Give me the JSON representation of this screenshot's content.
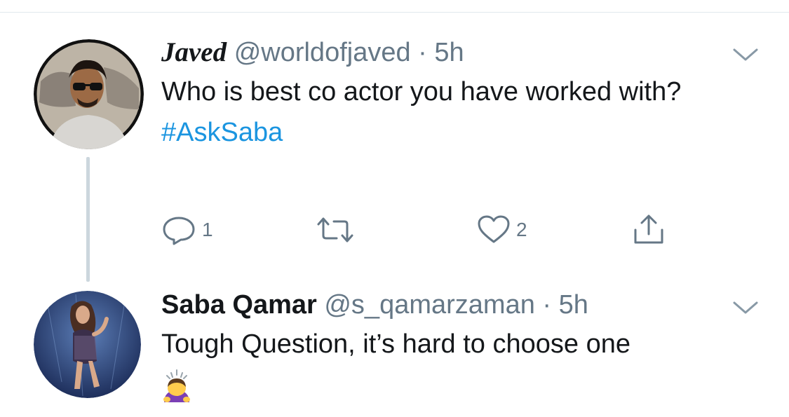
{
  "tweets": [
    {
      "display_name": "Javed",
      "handle": "@worldofjaved",
      "separator": "·",
      "time": "5h",
      "text": "Who is best co actor you have worked with?",
      "hashtag": "#AskSaba",
      "actions": {
        "reply_count": "1",
        "retweet_count": "",
        "like_count": "2"
      }
    },
    {
      "display_name": "Saba Qamar",
      "handle": "@s_qamarzaman",
      "separator": "·",
      "time": "5h",
      "text": "Tough Question, it’s hard to choose one",
      "emoji_icon": "person-bowing-icon"
    }
  ],
  "colors": {
    "link": "#1b95e0",
    "secondary_text": "#657786",
    "icon_gray": "#657786",
    "divider": "#e1e8ed",
    "thread_line": "#ccd6dd"
  },
  "icons": [
    "chevron-down-icon",
    "reply-icon",
    "retweet-icon",
    "heart-icon",
    "share-icon"
  ]
}
